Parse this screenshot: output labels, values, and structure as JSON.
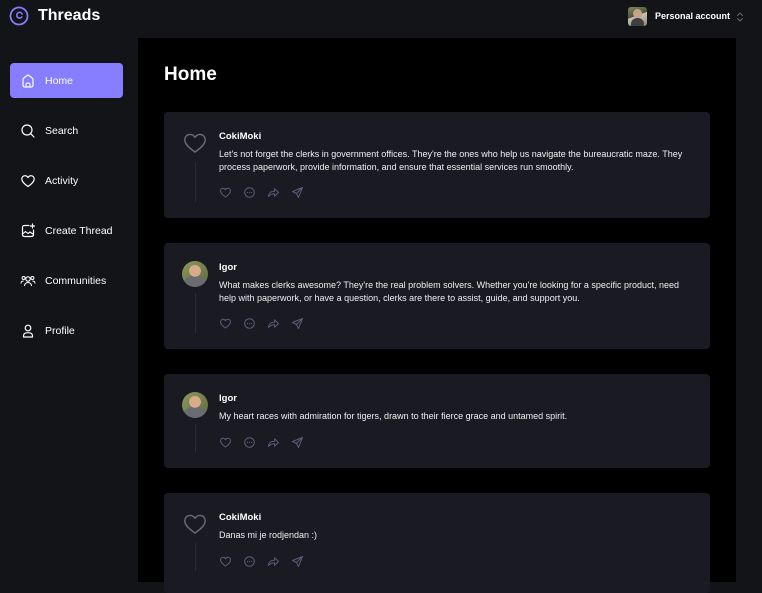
{
  "app": {
    "name": "Threads",
    "accent_color": "#877eff"
  },
  "account": {
    "label": "Personal account"
  },
  "sidebar": {
    "items": [
      {
        "label": "Home",
        "icon": "home-icon",
        "active": true
      },
      {
        "label": "Search",
        "icon": "search-icon",
        "active": false
      },
      {
        "label": "Activity",
        "icon": "heart-icon",
        "active": false
      },
      {
        "label": "Create Thread",
        "icon": "create-thread-icon",
        "active": false
      },
      {
        "label": "Communities",
        "icon": "communities-icon",
        "active": false
      },
      {
        "label": "Profile",
        "icon": "profile-icon",
        "active": false
      }
    ]
  },
  "main": {
    "title": "Home",
    "threads": [
      {
        "author": "CokiMoki",
        "avatar": "heart-placeholder",
        "text": "Let's not forget the clerks in government offices. They're the ones who help us navigate the bureaucratic maze. They process paperwork, provide information, and ensure that essential services run smoothly."
      },
      {
        "author": "Igor",
        "avatar": "photo",
        "text": "What makes clerks awesome? They're the real problem solvers. Whether you're looking for a specific product, need help with paperwork, or have a question, clerks are there to assist, guide, and support you."
      },
      {
        "author": "Igor",
        "avatar": "photo",
        "text": "My heart races with admiration for tigers, drawn to their fierce grace and untamed spirit."
      },
      {
        "author": "CokiMoki",
        "avatar": "heart-placeholder",
        "text": "Danas mi je rodjendan :)"
      }
    ],
    "action_icons": [
      "like-icon",
      "reply-icon",
      "repost-icon",
      "share-icon"
    ]
  }
}
